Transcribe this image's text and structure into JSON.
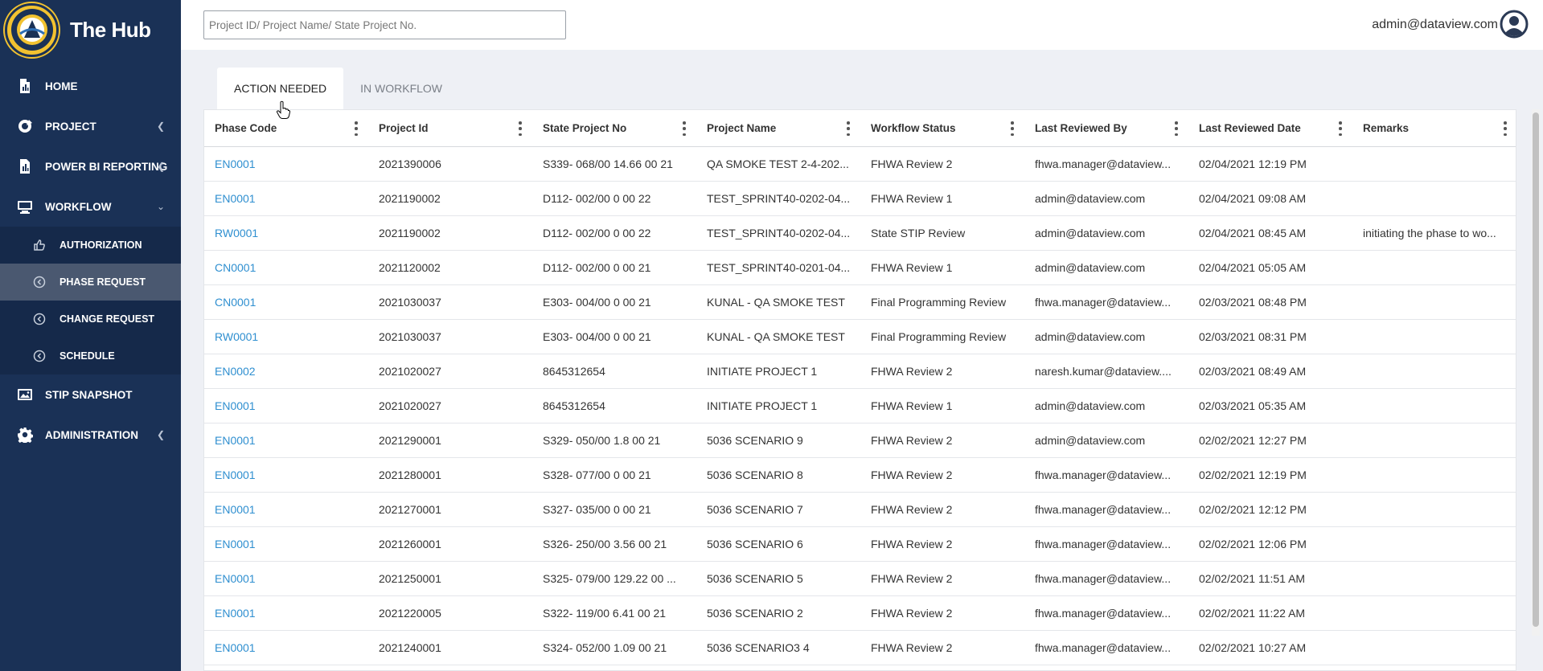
{
  "app": {
    "title": "The Hub"
  },
  "sidebar": {
    "items": [
      {
        "label": "HOME",
        "icon": "file-chart-icon"
      },
      {
        "label": "PROJECT",
        "icon": "project-icon"
      },
      {
        "label": "POWER BI REPORTING",
        "icon": "report-icon"
      },
      {
        "label": "WORKFLOW",
        "icon": "workflow-icon"
      },
      {
        "label": "STIP SNAPSHOT",
        "icon": "snapshot-icon"
      },
      {
        "label": "ADMINISTRATION",
        "icon": "gear-icon"
      }
    ],
    "workflow_sub": [
      {
        "label": "AUTHORIZATION",
        "icon": "thumbs-up-icon"
      },
      {
        "label": "PHASE REQUEST",
        "icon": "arrow-circle-icon"
      },
      {
        "label": "CHANGE REQUEST",
        "icon": "arrow-circle-icon"
      },
      {
        "label": "SCHEDULE",
        "icon": "arrow-circle-icon"
      }
    ]
  },
  "header": {
    "search_placeholder": "Project ID/ Project Name/ State Project No.",
    "user_email": "admin@dataview.com"
  },
  "tabs": [
    {
      "label": "ACTION NEEDED",
      "active": true
    },
    {
      "label": "IN WORKFLOW",
      "active": false
    }
  ],
  "table": {
    "columns": [
      "Phase Code",
      "Project Id",
      "State Project No",
      "Project Name",
      "Workflow Status",
      "Last Reviewed By",
      "Last Reviewed Date",
      "Remarks"
    ],
    "rows": [
      [
        "EN0001",
        "2021390006",
        "S339- 068/00 14.66 00 21",
        "QA SMOKE TEST 2-4-202...",
        "FHWA Review 2",
        "fhwa.manager@dataview...",
        "02/04/2021 12:19 PM",
        ""
      ],
      [
        "EN0001",
        "2021190002",
        "D112- 002/00 0 00 22",
        "TEST_SPRINT40-0202-04...",
        "FHWA Review 1",
        "admin@dataview.com",
        "02/04/2021 09:08 AM",
        ""
      ],
      [
        "RW0001",
        "2021190002",
        "D112- 002/00 0 00 22",
        "TEST_SPRINT40-0202-04...",
        "State STIP Review",
        "admin@dataview.com",
        "02/04/2021 08:45 AM",
        "initiating the phase to wo..."
      ],
      [
        "CN0001",
        "2021120002",
        "D112- 002/00 0 00 21",
        "TEST_SPRINT40-0201-04...",
        "FHWA Review 1",
        "admin@dataview.com",
        "02/04/2021 05:05 AM",
        ""
      ],
      [
        "CN0001",
        "2021030037",
        "E303- 004/00 0 00 21",
        "KUNAL - QA SMOKE TEST",
        "Final Programming Review",
        "fhwa.manager@dataview...",
        "02/03/2021 08:48 PM",
        ""
      ],
      [
        "RW0001",
        "2021030037",
        "E303- 004/00 0 00 21",
        "KUNAL - QA SMOKE TEST",
        "Final Programming Review",
        "admin@dataview.com",
        "02/03/2021 08:31 PM",
        ""
      ],
      [
        "EN0002",
        "2021020027",
        "8645312654",
        "INITIATE PROJECT 1",
        "FHWA Review 2",
        "naresh.kumar@dataview....",
        "02/03/2021 08:49 AM",
        ""
      ],
      [
        "EN0001",
        "2021020027",
        "8645312654",
        "INITIATE PROJECT 1",
        "FHWA Review 1",
        "admin@dataview.com",
        "02/03/2021 05:35 AM",
        ""
      ],
      [
        "EN0001",
        "2021290001",
        "S329- 050/00 1.8 00 21",
        "5036 SCENARIO 9",
        "FHWA Review 2",
        "admin@dataview.com",
        "02/02/2021 12:27 PM",
        ""
      ],
      [
        "EN0001",
        "2021280001",
        "S328- 077/00 0 00 21",
        "5036 SCENARIO 8",
        "FHWA Review 2",
        "fhwa.manager@dataview...",
        "02/02/2021 12:19 PM",
        ""
      ],
      [
        "EN0001",
        "2021270001",
        "S327- 035/00 0 00 21",
        "5036 SCENARIO 7",
        "FHWA Review 2",
        "fhwa.manager@dataview...",
        "02/02/2021 12:12 PM",
        ""
      ],
      [
        "EN0001",
        "2021260001",
        "S326- 250/00 3.56 00 21",
        "5036 SCENARIO 6",
        "FHWA Review 2",
        "fhwa.manager@dataview...",
        "02/02/2021 12:06 PM",
        ""
      ],
      [
        "EN0001",
        "2021250001",
        "S325- 079/00 129.22 00 ...",
        "5036 SCENARIO 5",
        "FHWA Review 2",
        "fhwa.manager@dataview...",
        "02/02/2021 11:51 AM",
        ""
      ],
      [
        "EN0001",
        "2021220005",
        "S322- 119/00 6.41 00 21",
        "5036 SCENARIO 2",
        "FHWA Review 2",
        "fhwa.manager@dataview...",
        "02/02/2021 11:22 AM",
        ""
      ],
      [
        "EN0001",
        "2021240001",
        "S324- 052/00 1.09 00 21",
        "5036 SCENARIO3 4",
        "FHWA Review 2",
        "fhwa.manager@dataview...",
        "02/02/2021 10:27 AM",
        ""
      ]
    ]
  },
  "colors": {
    "sidebar_bg": "#1a3156",
    "link": "#2f8fd0",
    "active_sub": "#4a5870"
  }
}
